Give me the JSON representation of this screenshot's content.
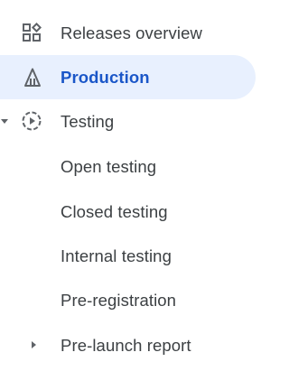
{
  "nav": {
    "items": [
      {
        "label": "Releases overview",
        "icon": "releases-overview-icon"
      },
      {
        "label": "Production",
        "icon": "production-icon",
        "selected": true
      },
      {
        "label": "Testing",
        "icon": "testing-icon",
        "expanded": true
      },
      {
        "label": "Open testing"
      },
      {
        "label": "Closed testing"
      },
      {
        "label": "Internal testing"
      },
      {
        "label": "Pre-registration"
      },
      {
        "label": "Pre-launch report",
        "expanded": false
      }
    ]
  },
  "colors": {
    "text": "#3c4043",
    "icon": "#5f6368",
    "selected_text": "#1a56c8",
    "selected_bg": "#e8f0fe"
  }
}
